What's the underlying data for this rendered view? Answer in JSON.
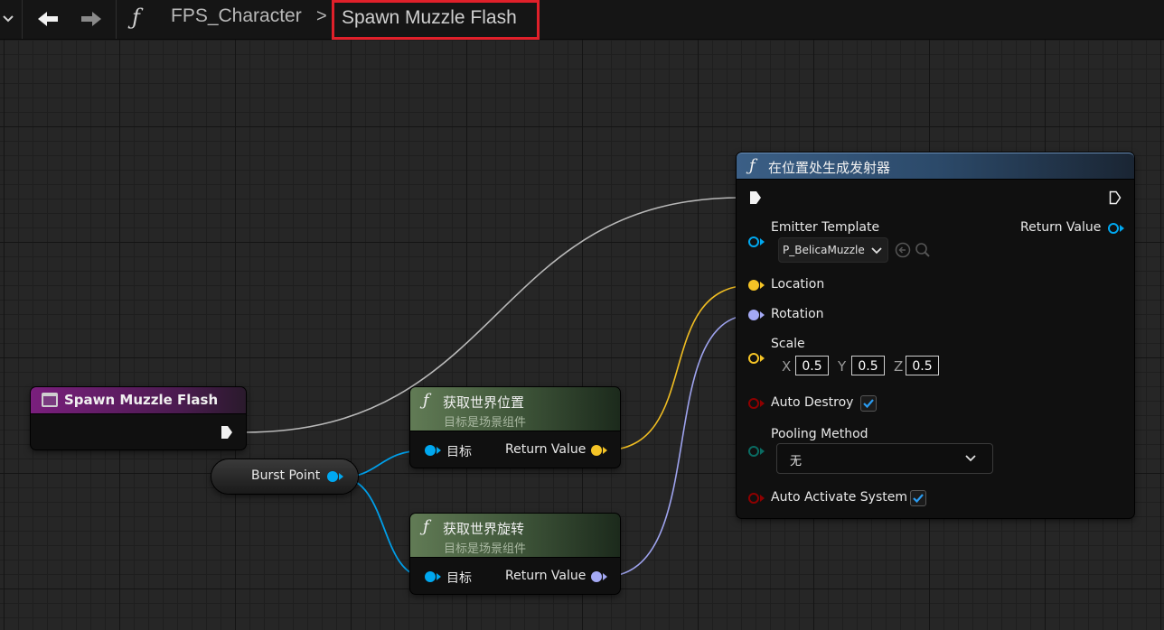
{
  "breadcrumb": {
    "function_symbol": "ƒ",
    "parent": "FPS_Character",
    "separator": ">",
    "current": "Spawn Muzzle Flash"
  },
  "colors": {
    "exec_wire": "#c8c8c8",
    "vector_pin": "#f5c426",
    "rotator_pin": "#a4a9f4",
    "object_pin": "#00a8f0",
    "bool_pin": "#8e0000",
    "enum_pin": "#0a6b62",
    "highlight_box": "#e0202a"
  },
  "nodes": {
    "event": {
      "title": "Spawn Muzzle Flash"
    },
    "burst_point": {
      "label": "Burst Point"
    },
    "get_location": {
      "title": "获取世界位置",
      "subtitle": "目标是场景组件",
      "input_label": "目标",
      "output_label": "Return Value"
    },
    "get_rotation": {
      "title": "获取世界旋转",
      "subtitle": "目标是场景组件",
      "input_label": "目标",
      "output_label": "Return Value"
    },
    "spawn_emitter": {
      "title": "在位置处生成发射器",
      "emitter_template_label": "Emitter Template",
      "emitter_template_value": "P_BelicaMuzzle",
      "return_value_label": "Return Value",
      "location_label": "Location",
      "rotation_label": "Rotation",
      "scale_label": "Scale",
      "scale": {
        "x_label": "X",
        "x": "0.5",
        "y_label": "Y",
        "y": "0.5",
        "z_label": "Z",
        "z": "0.5"
      },
      "auto_destroy_label": "Auto Destroy",
      "auto_destroy": true,
      "pooling_method_label": "Pooling Method",
      "pooling_method_value": "无",
      "auto_activate_label": "Auto Activate System",
      "auto_activate": true
    }
  }
}
